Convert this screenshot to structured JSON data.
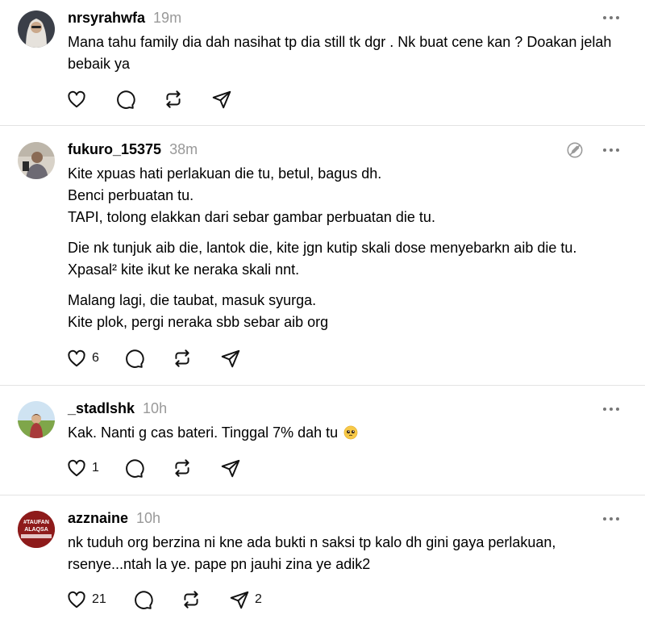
{
  "posts": [
    {
      "username": "nrsyrahwfa",
      "time": "19m",
      "avatar": "avatar-person-hijab",
      "lines": [
        "Mana tahu family dia dah nasihat tp dia still tk dgr . Nk buat cene kan ? Doakan jelah bebaik ya"
      ],
      "likes": "",
      "reposts": "",
      "shares": ""
    },
    {
      "username": "fukuro_15375",
      "time": "38m",
      "avatar": "avatar-person-car",
      "badge": "no-edit-pencil-icon",
      "para1": [
        "Kite xpuas hati perlakuan die tu, betul, bagus dh.",
        "Benci perbuatan tu.",
        "TAPI, tolong elakkan dari sebar gambar perbuatan die tu."
      ],
      "para2": [
        "Die nk tunjuk aib die, lantok die, kite jgn kutip skali dose menyebarkn aib die tu.",
        "Xpasal² kite ikut ke neraka skali nnt."
      ],
      "para3": [
        "Malang lagi, die taubat, masuk syurga.",
        "Kite plok, pergi neraka sbb sebar aib org"
      ],
      "likes": "6"
    },
    {
      "username": "_stadlshk",
      "time": "10h",
      "avatar": "avatar-person-field",
      "text": "Kak. Nanti g cas bateri. Tinggal 7% dah tu",
      "emoji": "pleading-face-emoji",
      "likes": "1"
    },
    {
      "username": "azznaine",
      "time": "10h",
      "avatar": "avatar-logo-red",
      "avatar_text_1": "#TAUFAN",
      "avatar_text_2": "ALAQSA",
      "lines": [
        "nk tuduh org berzina ni kne ada bukti n saksi tp kalo dh gini gaya perlakuan,",
        "rsenye...ntah la ye. pape pn jauhi zina ye adik2"
      ],
      "likes": "21",
      "shares": "2"
    }
  ],
  "icons": {
    "like": "heart-icon",
    "reply": "comment-bubble-icon",
    "repost": "repost-icon",
    "share": "share-send-icon",
    "more": "more-dots-icon"
  },
  "colors": {
    "username": "#000000",
    "time": "#999999",
    "divider": "#e3e3e3",
    "icon": "#111111"
  }
}
